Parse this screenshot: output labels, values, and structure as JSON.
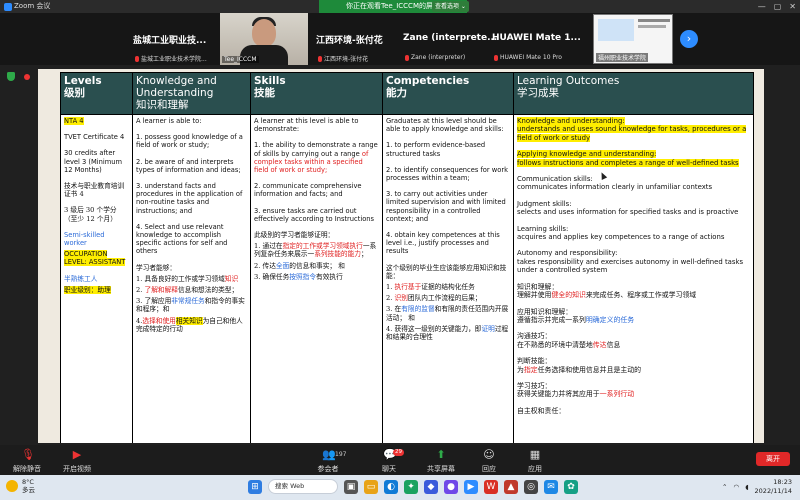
{
  "window": {
    "app_title": "Zoom 会议",
    "share_banner": "你正在观看Tee_ICCCM的屏幕",
    "view_options": "查看选项 ⌄",
    "controls": [
      "—",
      "▢",
      "✕"
    ]
  },
  "participants": {
    "tiles": [
      {
        "big": "盐城工业职业技...",
        "small": "盐城工业职业技术学院..."
      },
      {
        "big": "江西环境-张付花",
        "small": "江西环境-张付花"
      },
      {
        "big": "Zane (interprete...",
        "small": "Zane (interpreter)"
      },
      {
        "big": "HUAWEI Mate 1...",
        "small": "HUAWEI Mate 10 Pro"
      }
    ],
    "video_name": "Tee_ICCCM",
    "thumb_name": "福州职业技术学院"
  },
  "table": {
    "headers": [
      {
        "en": "Levels",
        "cn": "级别"
      },
      {
        "en": "Knowledge and Understanding",
        "cn": "知识和理解"
      },
      {
        "en": "Skills",
        "cn": "技能"
      },
      {
        "en": "Competencies",
        "cn": "能力"
      },
      {
        "en": "Learning Outcomes",
        "cn": "学习成果"
      }
    ],
    "levels": {
      "nta": "NTA 4",
      "tvet": "TVET Certificate 4",
      "credits": "30 credits after level 3 (Minimum 12 Months)",
      "cert_cn": "技术与职业教育培训证书 4",
      "time_cn": "3 级后 30 个学分（至少 12 个月）",
      "worker": "Semi-skilled worker",
      "occupation": "OCCUPATION LEVEL: ASSISTANT",
      "worker_cn": "半熟练工人",
      "occupation_cn": "职业级别：助理"
    },
    "knowledge": {
      "p1": "A learner is able to:",
      "p2": "1. possess good knowledge of a field of work or study;",
      "p3": "2. be aware of and interprets types of information and ideas;",
      "p4": "3. understand facts and procedures in the application of non-routine tasks and instructions; and",
      "p5": "4. Select and use relevant knowledge to accomplish specific actions for self and others",
      "cn1": "学习者能够：",
      "cn2a": "1. 具备良好的工作或学习领域",
      "cn2b": "知识",
      "cn3a": "2. ",
      "cn3b": "了解和解释",
      "cn3c": "信息和想法的类型；",
      "cn4a": "3. 了解应用",
      "cn4b": "非常规任务",
      "cn4c": "和指令的事实和程序；和",
      "cn5a": "4.",
      "cn5b": "选择和使用",
      "cn5c": "相关知识",
      "cn5d": "为自己和他人完成特定的行动"
    },
    "skills": {
      "p1": "A learner at this level is able to demonstrate:",
      "p2a": "1. the ability to demonstrate a range of skills by carrying out a range ",
      "p2b": "of complex tasks within a specified field of work or study;",
      "p3": "2. communicate comprehensive information and facts; and",
      "p4": "3. ensure tasks are carried out effectively according to Instructions",
      "cn1": "此级别的学习者能够证明：",
      "cn2a": "1. 通过在",
      "cn2b": "指定的工作或学习领域执行",
      "cn2c": "一系列复杂任务来展示一",
      "cn2d": "系列技能的能力",
      "cn2e": "；",
      "cn3a": "2. 传达",
      "cn3b": "全面",
      "cn3c": "的信息和事实；   和",
      "cn4a": "3. 确保任务",
      "cn4b": "按照指令",
      "cn4c": "有效执行"
    },
    "competencies": {
      "p1": "Graduates at this level should be able to apply knowledge and skills:",
      "p2": "1. to perform evidence-based structured tasks",
      "p3": "2. to identify consequences for work processes within a team;",
      "p4": "3. to carry out activities under limited supervision and with limited responsibility in a controlled context; and",
      "p5": "4. obtain key competences at this level i.e., justify processes and results",
      "cn1": "这个级别的毕业生应该能够应用知识和技能：",
      "cn2a": "1. ",
      "cn2b": "执行基于",
      "cn2c": "证据的结构化任务",
      "cn3a": "2. ",
      "cn3b": "识别",
      "cn3c": "团队内工作流程的后果；",
      "cn4a": "3. 在",
      "cn4b": "有限的监督",
      "cn4c": "和有限的责任范围内开展活动；  和",
      "cn5a": "4. 获得这一级别的关键能力，即",
      "cn5b": "证明",
      "cn5c": "过程和结果的合理性"
    },
    "outcomes": {
      "ku_t": "Knowledge and understanding:",
      "ku_d": "understands and uses sound knowledge for tasks, procedures or a field of work or study",
      "ap_t": "Applying knowledge and understanding:",
      "ap_d": "follows instructions and completes a range of well-defined tasks",
      "cs_t": "Communication skills:",
      "cs_d": "communicates information clearly in unfamiliar contexts",
      "js_t": "Judgment skills:",
      "js_d": "selects and uses information for specified tasks and is proactive",
      "ls_t": "Learning skills:",
      "ls_d": "acquires and applies key competences to a range of actions",
      "ar_t": "Autonomy and responsibility:",
      "ar_d": "takes responsibility and exercises autonomy in well-defined tasks under a controlled system",
      "cn_ku_t": "知识和理解：",
      "cn_ku_a": "理解并使用",
      "cn_ku_b": "健全的知识",
      "cn_ku_c": "来完成任务、程序或工作或学习领域",
      "cn_ap_t": "应用知识和理解：",
      "cn_ap_a": "遵循指示并完成一系列",
      "cn_ap_b": "明确定义的任务",
      "cn_cs_t": "沟通技巧：",
      "cn_cs_a": "在不熟悉的环境中清楚地",
      "cn_cs_b": "传达",
      "cn_cs_c": "信息",
      "cn_js_t": "判断技能：",
      "cn_js_a": "为",
      "cn_js_b": "指定",
      "cn_js_c": "任务选择和使用信息并且是主动的",
      "cn_ls_t": "学习技巧：",
      "cn_ls_a": "获得关键能力并将其应用于",
      "cn_ls_b": "一系列行动",
      "cn_ar_t": "自主权和责任："
    }
  },
  "toolbar": {
    "mute": "解除静音",
    "video": "开启视频",
    "participants": "参会者",
    "participant_count": "197",
    "chat": "聊天",
    "chat_badge": "29",
    "share": "共享屏幕",
    "react": "回应",
    "apps": "应用",
    "leave": "离开"
  },
  "taskbar": {
    "temp": "8°C",
    "weather": "多云",
    "search": "搜索 Web",
    "time": "18:23",
    "date": "2022/11/14"
  },
  "colors": {
    "header_bg": "#2a4f4f",
    "highlight": "#ffee00",
    "red_text": "#e02020",
    "blue_text": "#2a6ad8",
    "zoom_blue": "#2d8cff",
    "share_green": "#1e8a3a"
  }
}
